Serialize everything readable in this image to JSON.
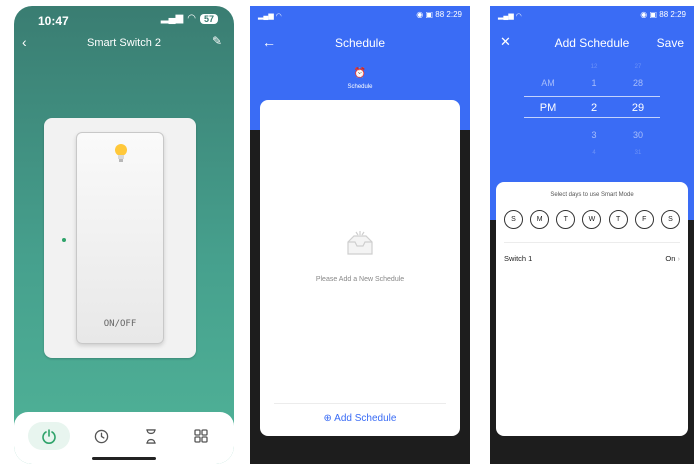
{
  "screen1": {
    "status_time": "10:47",
    "battery": "57",
    "title": "Smart Switch 2",
    "switch_label": "ON/OFF",
    "accent_color": "#2fa36a",
    "tabs": [
      {
        "icon": "power-icon",
        "active": true
      },
      {
        "icon": "clock-icon",
        "active": false
      },
      {
        "icon": "hourglass-icon",
        "active": false
      },
      {
        "icon": "grid-icon",
        "active": false
      }
    ]
  },
  "screen2": {
    "status_time": "2:29",
    "battery": "88",
    "title": "Schedule",
    "tab_label": "Schedule",
    "empty_text": "Please Add a New Schedule",
    "add_label": "Add Schedule",
    "accent_color": "#3a6cf5"
  },
  "screen3": {
    "status_time": "2:29",
    "battery": "88",
    "title": "Add Schedule",
    "save_label": "Save",
    "picker": {
      "ampm": {
        "above": "AM",
        "selected": "PM"
      },
      "hour": {
        "faint_above": "12",
        "above": "1",
        "selected": "2",
        "below": "3",
        "faint_below": "4"
      },
      "minute": {
        "faint_above": "27",
        "above": "28",
        "selected": "29",
        "below": "30",
        "faint_below": "31"
      }
    },
    "days_label": "Select days to use Smart Mode",
    "days": [
      "S",
      "M",
      "T",
      "W",
      "T",
      "F",
      "S"
    ],
    "switch_row": {
      "label": "Switch 1",
      "value": "On"
    }
  }
}
